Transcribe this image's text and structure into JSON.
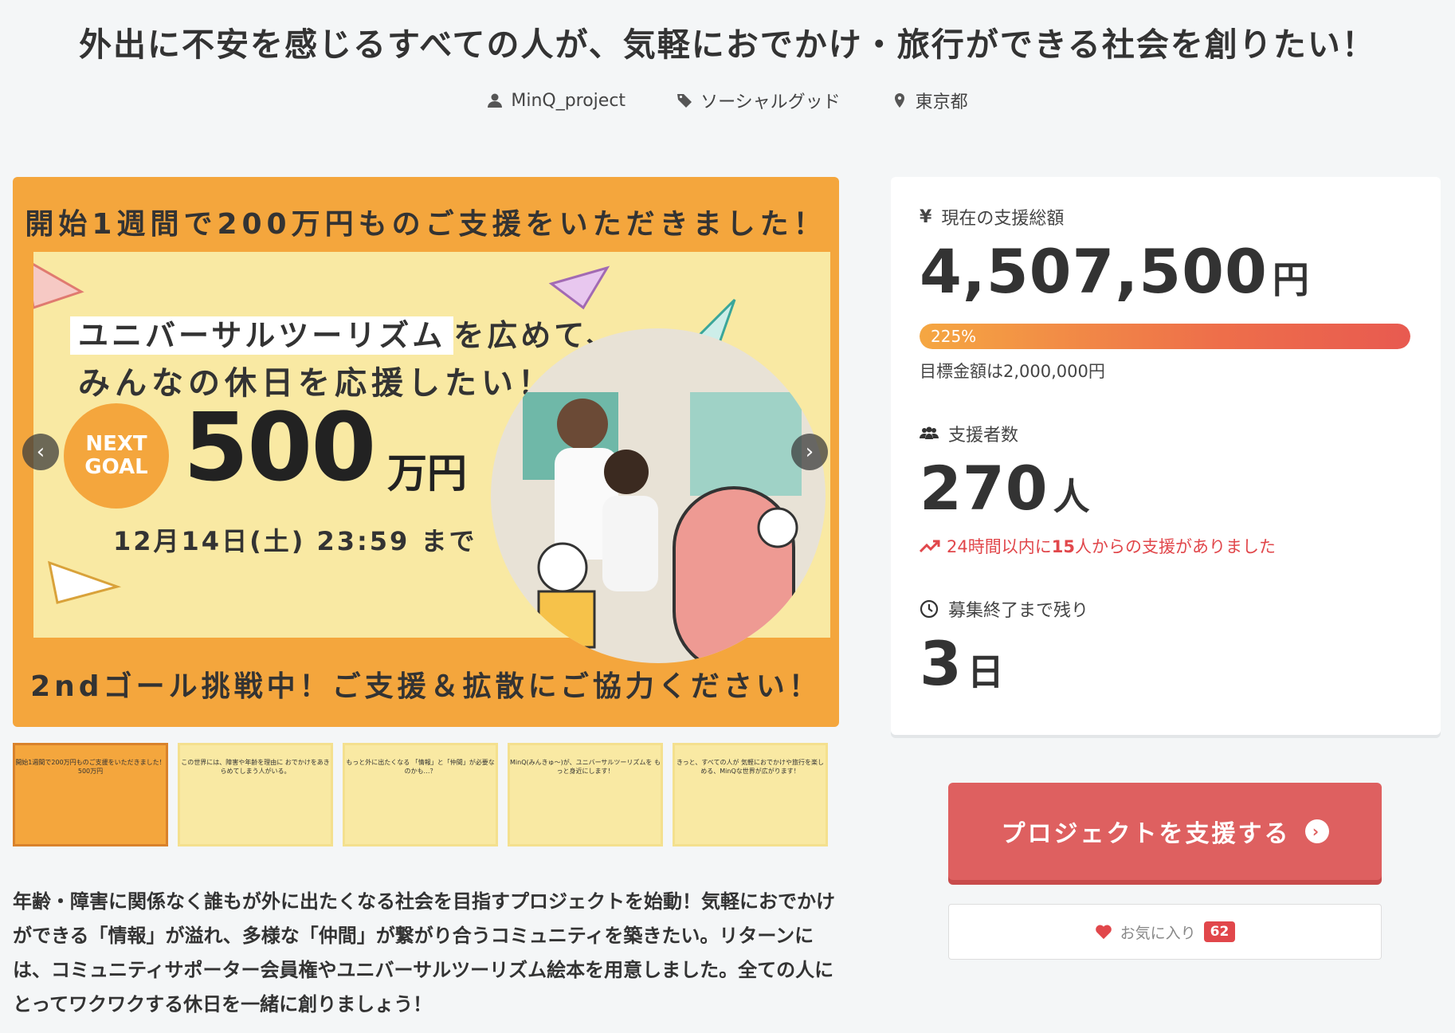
{
  "title": "外出に不安を感じるすべての人が、気軽におでかけ・旅行ができる社会を創りたい！",
  "meta": {
    "owner": "MinQ_project",
    "category": "ソーシャルグッド",
    "location": "東京都"
  },
  "hero": {
    "top_text": "開始1週間で200万円ものご支援をいただきました！",
    "headline_highlight": "ユニバーサルツーリズム",
    "headline_rest": "を広めて、",
    "headline2": "みんなの休日を応援したい！",
    "badge_line1": "NEXT",
    "badge_line2": "GOAL",
    "goal_number": "500",
    "goal_unit": "万円",
    "deadline": "12月14日(土) 23:59 まで",
    "bottom_text": "2ndゴール挑戦中！ご支援＆拡散にご協力ください！",
    "prev_icon": "‹",
    "next_icon": "›"
  },
  "thumbnails": [
    {
      "text": "開始1週間で200万円ものご支援をいただきました！ 500万円"
    },
    {
      "text": "この世界には、障害や年齢を理由に おでかけをあきらめてしまう人がいる。"
    },
    {
      "text": "もっと外に出たくなる 「情報」と「仲間」が必要なのかも…？"
    },
    {
      "text": "MinQ(みんきゅ〜)が、ユニバーサルツーリズムを もっと身近にします！"
    },
    {
      "text": "きっと、すべての人が 気軽におでかけや旅行を楽しめる、MinQな世界が広がります！"
    }
  ],
  "description": "年齢・障害に関係なく誰もが外に出たくなる社会を目指すプロジェクトを始動！気軽におでかけができる「情報」が溢れ、多様な「仲間」が繋がり合うコミュニティを築きたい。リターンには、コミュニティサポーター会員権やユニバーサルツーリズム絵本を用意しました。全ての人にとってワクワクする休日を一緒に創りましょう！",
  "stats": {
    "total_label": "現在の支援総額",
    "total_icon": "¥",
    "total_amount": "4,507,500",
    "total_unit": "円",
    "progress_label": "225%",
    "progress_value": 2.25,
    "goal_text": "目標金額は2,000,000円",
    "supporters_label": "支援者数",
    "supporters_count": "270",
    "supporters_unit": "人",
    "recent_prefix": "24時間以内に",
    "recent_count": "15",
    "recent_suffix": "人からの支援がありました",
    "remaining_label": "募集終了まで残り",
    "remaining_count": "3",
    "remaining_unit": "日"
  },
  "actions": {
    "support_label": "プロジェクトを支援する",
    "favorite_label": "お気に入り",
    "favorite_count": "62"
  },
  "colors": {
    "accent": "#de6060",
    "hero_orange": "#f4a63d",
    "hero_yellow": "#f9e9a3",
    "alert_red": "#e1474b"
  }
}
